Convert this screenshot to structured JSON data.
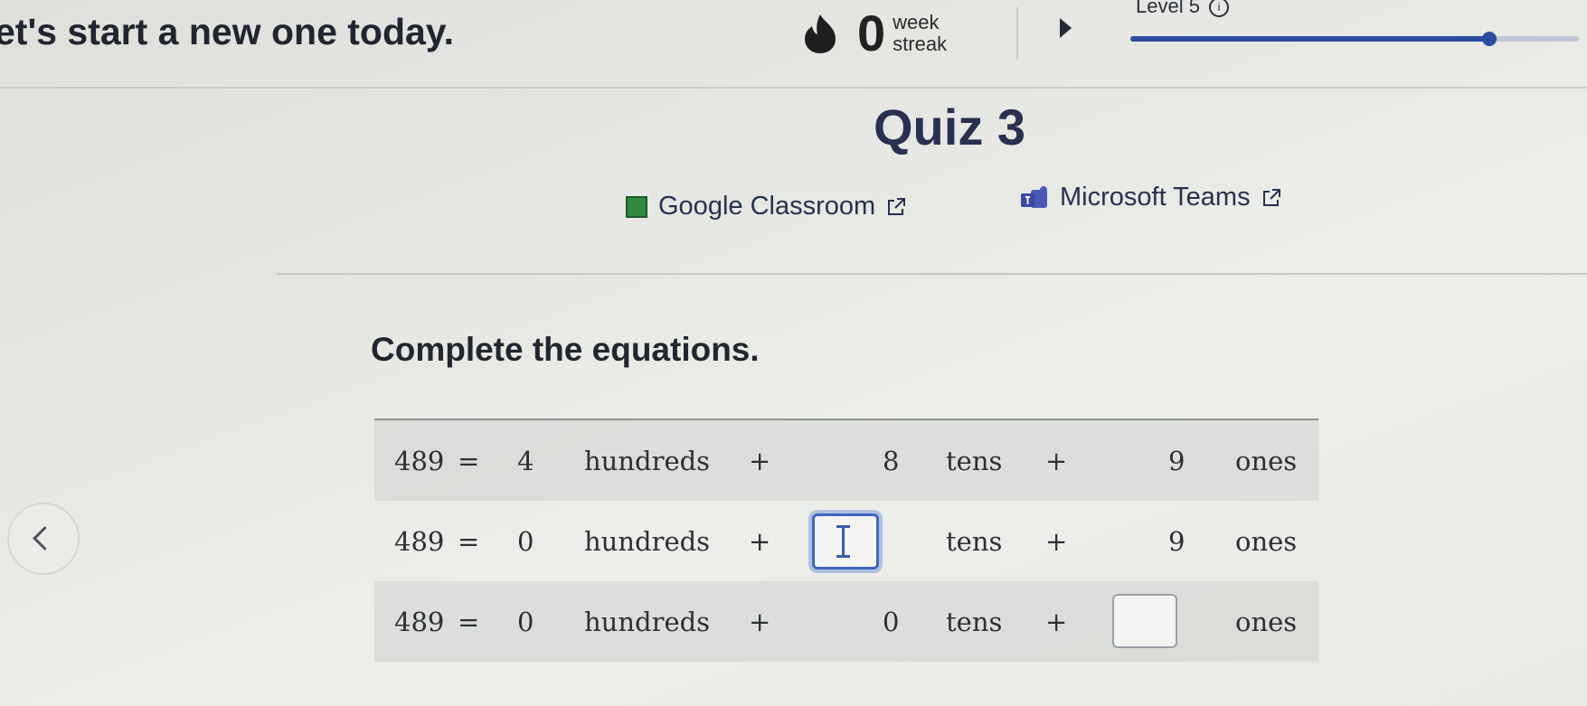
{
  "header": {
    "greeting": "et's start a new one today.",
    "streak": {
      "count": "0",
      "unit_top": "week",
      "unit_bottom": "streak",
      "icon": "flame-icon"
    },
    "level": {
      "label": "Level 5",
      "info_icon": "ⓘ",
      "progress": 0.8
    }
  },
  "quiz": {
    "title": "Quiz 3",
    "share_links": [
      {
        "label": "Google Classroom",
        "icon": "google-classroom-icon"
      },
      {
        "label": "Microsoft Teams",
        "icon": "microsoft-teams-icon"
      }
    ]
  },
  "exercise": {
    "instructions": "Complete the equations.",
    "rows": [
      {
        "lhs": "489",
        "eq": "=",
        "hundreds": "4",
        "hundreds_word": "hundreds",
        "plus1": "+",
        "tens": "8",
        "tens_word": "tens",
        "plus2": "+",
        "ones": "9",
        "ones_word": "ones"
      },
      {
        "lhs": "489",
        "eq": "=",
        "hundreds": "0",
        "hundreds_word": "hundreds",
        "plus1": "+",
        "tens": "",
        "tens_word": "tens",
        "plus2": "+",
        "ones": "9",
        "ones_word": "ones"
      },
      {
        "lhs": "489",
        "eq": "=",
        "hundreds": "0",
        "hundreds_word": "hundreds",
        "plus1": "+",
        "tens": "0",
        "tens_word": "tens",
        "plus2": "+",
        "ones": "",
        "ones_word": "ones"
      }
    ]
  },
  "colors": {
    "accent": "#2c4ca0",
    "focus": "#3f66c3",
    "background": "#e6e7e3"
  }
}
